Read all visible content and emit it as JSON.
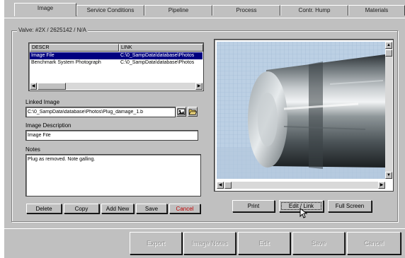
{
  "tabs": [
    "Image",
    "Service Conditions",
    "Pipeline",
    "Process",
    "Contr. Hump",
    "Materials"
  ],
  "frame_title": "Valve: #2X / 2625142 / N/A",
  "list": {
    "columns": [
      "DESCR",
      "LINK"
    ],
    "rows": [
      {
        "descr": "Image File",
        "link": "C:\\0_SampData\\database\\Photos",
        "selected": true
      },
      {
        "descr": "Benchmark System Photograph",
        "link": "C:\\0_SampData\\database\\Photos",
        "selected": false
      }
    ]
  },
  "linked_image": {
    "label": "Linked Image",
    "value": "C:\\0_SampData\\database\\Photos\\Plug_damage_1.b"
  },
  "image_description": {
    "label": "Image Description",
    "value": "Image File"
  },
  "notes": {
    "label": "Notes",
    "value": "Plug as removed. Note galling."
  },
  "record_buttons": {
    "delete": "Delete",
    "copy": "Copy",
    "add_new": "Add New",
    "save": "Save",
    "cancel": "Cancel"
  },
  "viewer_buttons": {
    "print": "Print",
    "edit_link": "Edit / Link",
    "full_screen": "Full Screen"
  },
  "bottom_buttons": {
    "export": "Export",
    "image_notes": "Image Notes",
    "edit": "Edit",
    "save": "Save",
    "cancel": "Cancel"
  },
  "icons": [
    "folder-open-icon",
    "image-browse-icon",
    "mouse-cursor-icon"
  ],
  "colors": {
    "selection": "#000080",
    "cancel_text": "#c00000",
    "face": "#c0c0c0"
  }
}
